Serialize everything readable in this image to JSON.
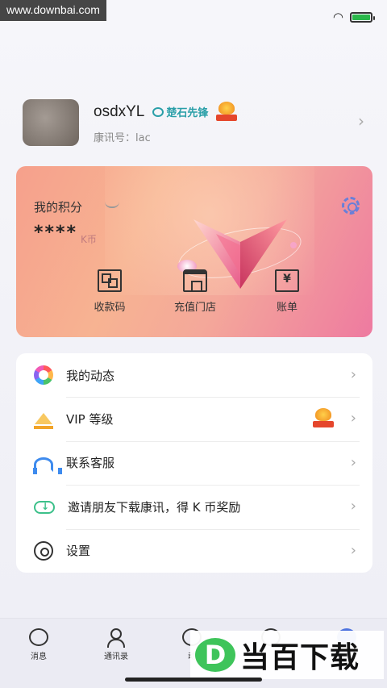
{
  "watermark_top": "www.downbai.com",
  "status_bar": {
    "icons": [
      "wifi-icon",
      "battery-icon"
    ]
  },
  "profile": {
    "username": "osdxYL",
    "pioneer_badge": "楚石先锋",
    "kangxun_id": "康讯号：lac"
  },
  "points_card": {
    "title": "我的积分",
    "masked_value": "****",
    "unit": "K币",
    "actions": [
      {
        "label": "收款码",
        "icon": "qr-code-icon"
      },
      {
        "label": "充值门店",
        "icon": "shop-icon"
      },
      {
        "label": "账单",
        "icon": "bill-icon"
      }
    ],
    "bill_symbol": "¥"
  },
  "menu": {
    "items": [
      {
        "label": "我的动态",
        "icon": "moments-icon"
      },
      {
        "label": "VIP 等级",
        "icon": "crown-icon"
      },
      {
        "label": "联系客服",
        "icon": "headset-icon"
      },
      {
        "label": "邀请朋友下载康讯，得 K 币奖励",
        "icon": "cloud-download-icon"
      },
      {
        "label": "设置",
        "icon": "settings-icon"
      }
    ],
    "chevron": "›"
  },
  "tab_bar": {
    "tabs": [
      {
        "label": "消息",
        "icon": "message-icon"
      },
      {
        "label": "通讯录",
        "icon": "contacts-icon"
      },
      {
        "label": "动",
        "icon": "moments-tab-icon"
      },
      {
        "label": "",
        "icon": "discover-icon"
      },
      {
        "label": "",
        "icon": "me-icon"
      }
    ]
  },
  "watermark_bottom": {
    "logo": "D",
    "text": "当百下载"
  },
  "colors": {
    "accent_blue": "#6a7fd8",
    "card_gradient_start": "#f6a08c",
    "card_gradient_end": "#ee7aa0",
    "pioneer_teal": "#2a9fa8"
  }
}
